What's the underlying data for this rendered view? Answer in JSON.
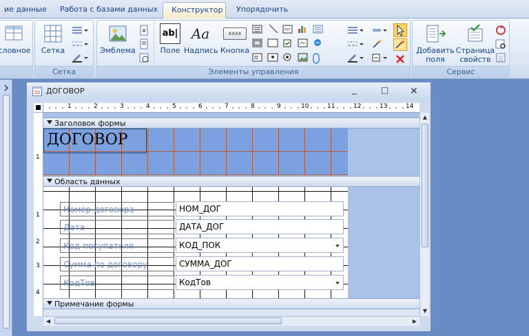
{
  "tabs": [
    {
      "label": "ие данные",
      "active": false
    },
    {
      "label": "Работа с базами данных",
      "active": false
    },
    {
      "label": "Конструктор",
      "active": true
    },
    {
      "label": "Упорядочить",
      "active": false
    }
  ],
  "ribbon": {
    "groups": [
      {
        "label": ""
      },
      {
        "label": "Сетка"
      },
      {
        "label": "Элементы управления"
      },
      {
        "label": "Сервис"
      }
    ],
    "buttons": {
      "conditional": "словное",
      "grid": "Сетка",
      "logo": "Эмблема",
      "field": "Поле",
      "label": "Надпись",
      "button": "Кнопка",
      "add_fields": "Добавить\nполя",
      "property_sheet": "Страница\nсвойств"
    },
    "icon_text": {
      "field": "ab|",
      "label": "Aa",
      "button": "xxxx"
    }
  },
  "form_window": {
    "title": "ДОГОВОР",
    "sections": {
      "header": "Заголовок формы",
      "detail": "Область данных",
      "footer": "Примечание формы"
    },
    "header_title": "ДОГОВОР",
    "fields": [
      {
        "label": "Номер договора",
        "control": "НОМ_ДОГ",
        "combo": false
      },
      {
        "label": "Дата",
        "control": "ДАТА_ДОГ",
        "combo": false
      },
      {
        "label": "Код покупателя",
        "control": "КОД_ПОК",
        "combo": true
      },
      {
        "label": "Сумма по договору",
        "control": "СУММА_ДОГ",
        "combo": false
      },
      {
        "label": "КодТов",
        "control": "КодТов",
        "combo": true
      }
    ],
    "ruler_numbers": [
      "1",
      "2",
      "3",
      "4",
      "5",
      "6",
      "7",
      "8",
      "9",
      "10",
      "11",
      "12",
      "13",
      "14"
    ],
    "vruler_header": [
      "1"
    ],
    "vruler_detail": [
      "1",
      "2",
      "3",
      "4"
    ]
  },
  "colors": {
    "accent": "#15428b",
    "header_bg": "#7ba1e0",
    "selected_tab": "#f6e9c8"
  }
}
